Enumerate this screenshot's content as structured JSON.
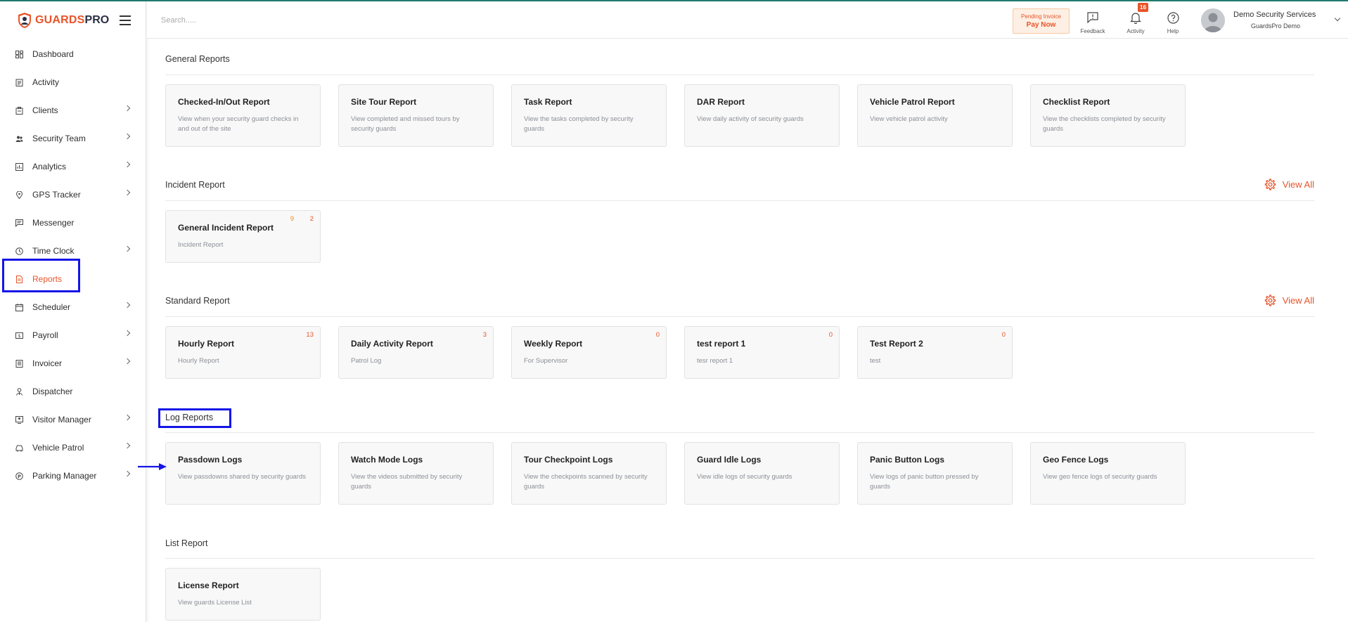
{
  "app": {
    "brand_left": "GUARDS",
    "brand_right": "PRO",
    "accent_color": "#e8542a",
    "highlight_color": "#1515e6"
  },
  "sidebar": {
    "items": [
      {
        "label": "Dashboard",
        "icon": "dashboard-icon",
        "chevron": false
      },
      {
        "label": "Activity",
        "icon": "activity-icon",
        "chevron": false
      },
      {
        "label": "Clients",
        "icon": "clients-icon",
        "chevron": true
      },
      {
        "label": "Security Team",
        "icon": "team-icon",
        "chevron": true
      },
      {
        "label": "Analytics",
        "icon": "analytics-icon",
        "chevron": true
      },
      {
        "label": "GPS Tracker",
        "icon": "location-pin-icon",
        "chevron": true
      },
      {
        "label": "Messenger",
        "icon": "message-icon",
        "chevron": false
      },
      {
        "label": "Time Clock",
        "icon": "clock-icon",
        "chevron": true
      },
      {
        "label": "Reports",
        "icon": "report-icon",
        "chevron": false,
        "active": true
      },
      {
        "label": "Scheduler",
        "icon": "calendar-icon",
        "chevron": true
      },
      {
        "label": "Payroll",
        "icon": "payroll-icon",
        "chevron": true
      },
      {
        "label": "Invoicer",
        "icon": "invoice-icon",
        "chevron": true
      },
      {
        "label": "Dispatcher",
        "icon": "dispatcher-icon",
        "chevron": false
      },
      {
        "label": "Visitor Manager",
        "icon": "visitor-icon",
        "chevron": true
      },
      {
        "label": "Vehicle Patrol",
        "icon": "vehicle-icon",
        "chevron": true
      },
      {
        "label": "Parking Manager",
        "icon": "parking-icon",
        "chevron": true
      }
    ]
  },
  "header": {
    "search_placeholder": "Search.....",
    "pending_invoice": "Pending Invoice",
    "pay_now": "Pay Now",
    "feedback": "Feedback",
    "activity": "Activity",
    "activity_count": "16",
    "help": "Help",
    "user_name": "Demo Security Services",
    "user_company": "GuardsPro Demo"
  },
  "sections": {
    "general": {
      "title": "General Reports",
      "cards": [
        {
          "title": "Checked-In/Out Report",
          "desc": "View when your security guard checks in and out of the site"
        },
        {
          "title": "Site Tour Report",
          "desc": "View completed and missed tours by security guards"
        },
        {
          "title": "Task Report",
          "desc": "View the tasks completed by security guards"
        },
        {
          "title": "DAR Report",
          "desc": "View daily activity of security guards"
        },
        {
          "title": "Vehicle Patrol Report",
          "desc": "View vehicle patrol activity"
        },
        {
          "title": "Checklist Report",
          "desc": "View the checklists completed by security guards"
        }
      ]
    },
    "incident": {
      "title": "Incident Report",
      "view_all": "View All",
      "cards": [
        {
          "title": "General Incident Report",
          "desc": "Incident Report",
          "count_a": "9",
          "count_b": "2"
        }
      ]
    },
    "standard": {
      "title": "Standard Report",
      "view_all": "View All",
      "cards": [
        {
          "title": "Hourly Report",
          "desc": "Hourly Report",
          "count": "13"
        },
        {
          "title": "Daily Activity Report",
          "desc": "Patrol Log",
          "count": "3"
        },
        {
          "title": "Weekly Report",
          "desc": "For Supervisor",
          "count": "0"
        },
        {
          "title": "test report 1",
          "desc": "tesr report 1",
          "count": "0"
        },
        {
          "title": "Test Report 2",
          "desc": "test",
          "count": "0"
        }
      ]
    },
    "log": {
      "title": "Log Reports",
      "cards": [
        {
          "title": "Passdown Logs",
          "desc": "View passdowns shared by security guards"
        },
        {
          "title": "Watch Mode Logs",
          "desc": "View the videos submitted by security guards"
        },
        {
          "title": "Tour Checkpoint Logs",
          "desc": "View the checkpoints scanned by security guards"
        },
        {
          "title": "Guard Idle Logs",
          "desc": "View idle logs of security guards"
        },
        {
          "title": "Panic Button Logs",
          "desc": "View logs of panic button pressed by guards"
        },
        {
          "title": "Geo Fence Logs",
          "desc": "View geo fence logs of security guards"
        }
      ]
    },
    "list": {
      "title": "List Report",
      "cards": [
        {
          "title": "License Report",
          "desc": "View guards License List"
        }
      ]
    }
  }
}
